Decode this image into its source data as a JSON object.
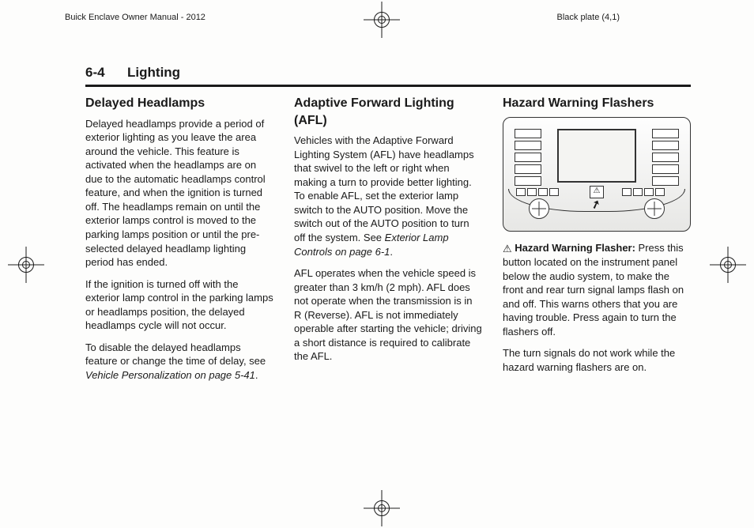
{
  "header": {
    "left": "Buick Enclave Owner Manual - 2012",
    "right": "Black plate (4,1)"
  },
  "section": {
    "page": "6-4",
    "title": "Lighting"
  },
  "col1": {
    "h": "Delayed Headlamps",
    "p1": "Delayed headlamps provide a period of exterior lighting as you leave the area around the vehicle. This feature is activated when the headlamps are on due to the automatic headlamps control feature, and when the ignition is turned off. The headlamps remain on until the exterior lamps control is moved to the parking lamps position or until the pre-selected delayed headlamp lighting period has ended.",
    "p2": "If the ignition is turned off with the exterior lamp control in the parking lamps or headlamps position, the delayed headlamps cycle will not occur.",
    "p3a": "To disable the delayed headlamps feature or change the time of delay, see ",
    "p3b_ital": "Vehicle Personalization on page 5-41",
    "p3c": "."
  },
  "col2": {
    "h": "Adaptive Forward Lighting (AFL)",
    "p1a": "Vehicles with the Adaptive Forward Lighting System (AFL) have headlamps that swivel to the left or right when making a turn to provide better lighting. To enable AFL, set the exterior lamp switch to the AUTO position. Move the switch out of the AUTO position to turn off the system. See ",
    "p1b_ital": "Exterior Lamp Controls on page 6-1",
    "p1c": ".",
    "p2": "AFL operates when the vehicle speed is greater than 3 km/h (2 mph). AFL does not operate when the transmission is in R (Reverse). AFL is not immediately operable after starting the vehicle; driving a short distance is required to calibrate the AFL."
  },
  "col3": {
    "h": "Hazard Warning Flashers",
    "s_label": "Hazard Warning Flasher:",
    "p1": " Press this button located on the instrument panel below the audio system, to make the front and rear turn signal lamps flash on and off. This warns others that you are having trouble. Press again to turn the flashers off.",
    "p2": "The turn signals do not work while the hazard warning flashers are on.",
    "glyph": "⚠"
  },
  "dash_icons": {
    "haz": "⚠"
  }
}
